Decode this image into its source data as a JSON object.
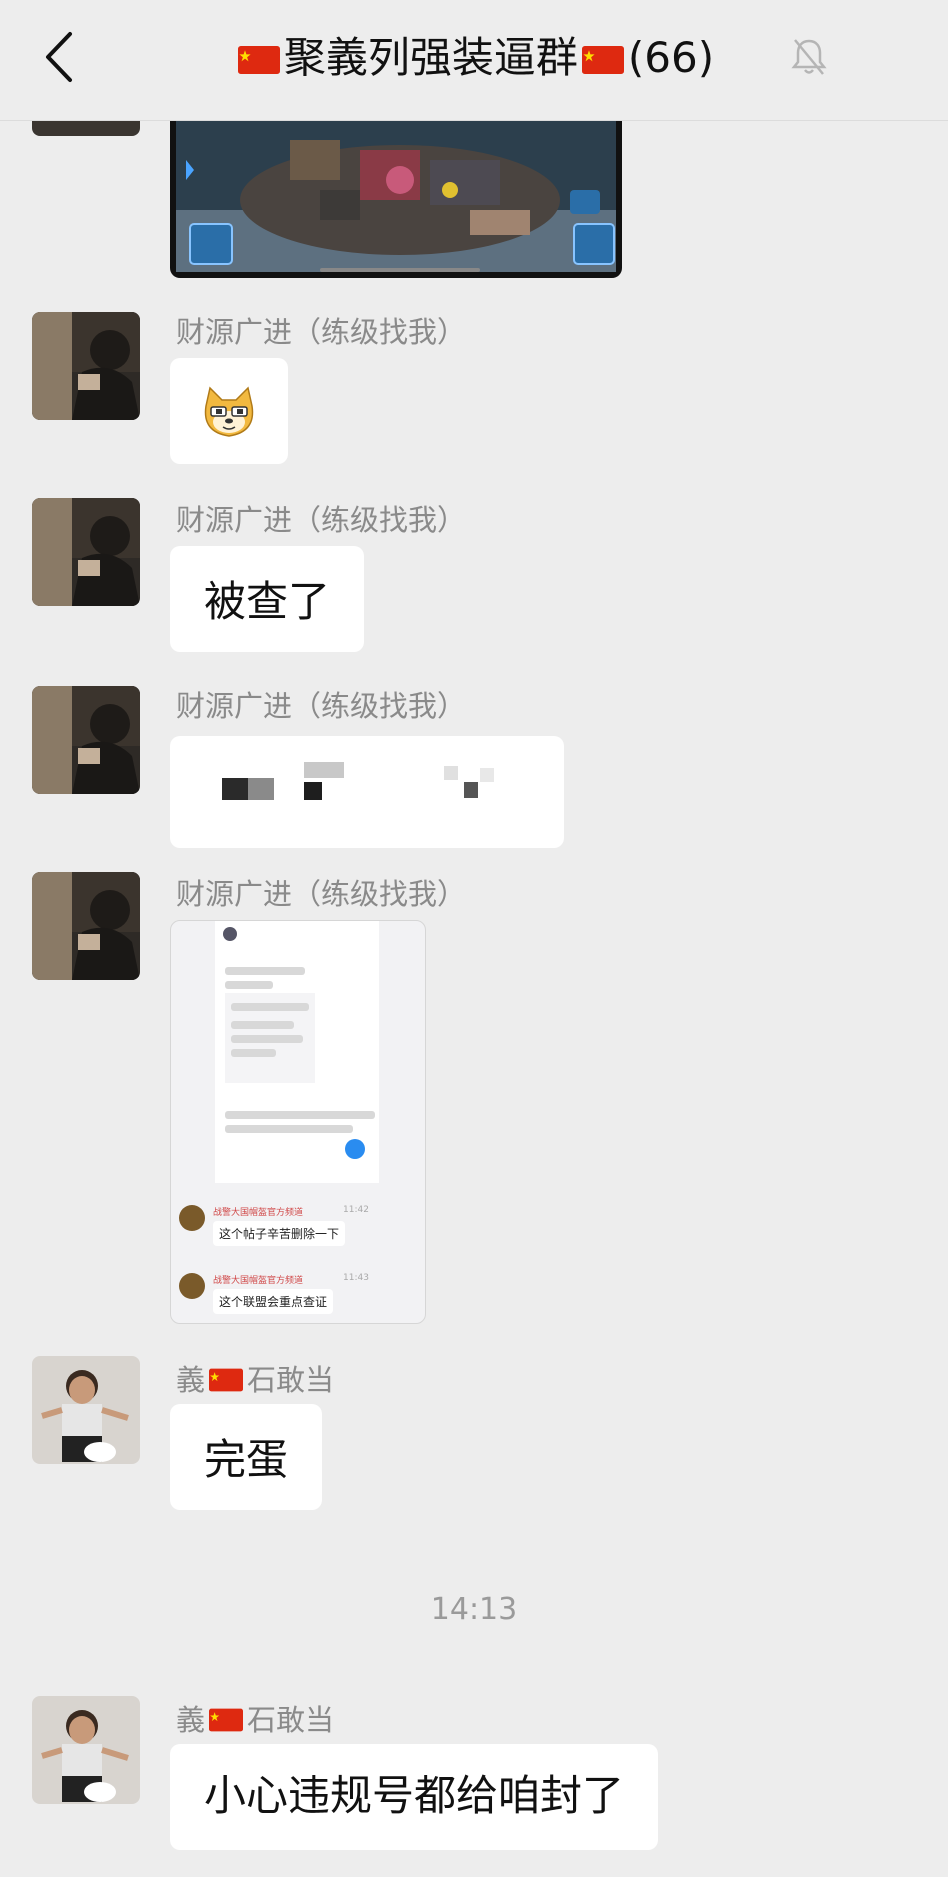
{
  "header": {
    "title": "聚義列强装逼群",
    "count": "(66)"
  },
  "messages": [
    {
      "sender": "财源广进（练级找我）",
      "type": "emoji",
      "emoji_name": "doge-emoji"
    },
    {
      "sender": "财源广进（练级找我）",
      "type": "text",
      "text": "被查了"
    },
    {
      "sender": "财源广进（练级找我）",
      "type": "redacted"
    },
    {
      "sender": "财源广进（练级找我）",
      "type": "image",
      "inner": {
        "row1_name": "战警大国帽盔官方频道",
        "row1_text": "这个帖子辛苦删除一下",
        "row1_time": "11:42",
        "row2_name": "战警大国帽盔官方频道",
        "row2_text": "这个联盟会重点查证",
        "row2_time": "11:43"
      }
    },
    {
      "sender_prefix": "義",
      "sender_suffix": "石敢当",
      "type": "text",
      "text": "完蛋"
    },
    {
      "sender_prefix": "義",
      "sender_suffix": "石敢当",
      "type": "text",
      "text": "小心违规号都给咱封了"
    }
  ],
  "timestamp": "14:13",
  "colors": {
    "background": "#ededed",
    "bubble": "#ffffff",
    "flag_red": "#de2910",
    "flag_yellow": "#ffde00"
  }
}
